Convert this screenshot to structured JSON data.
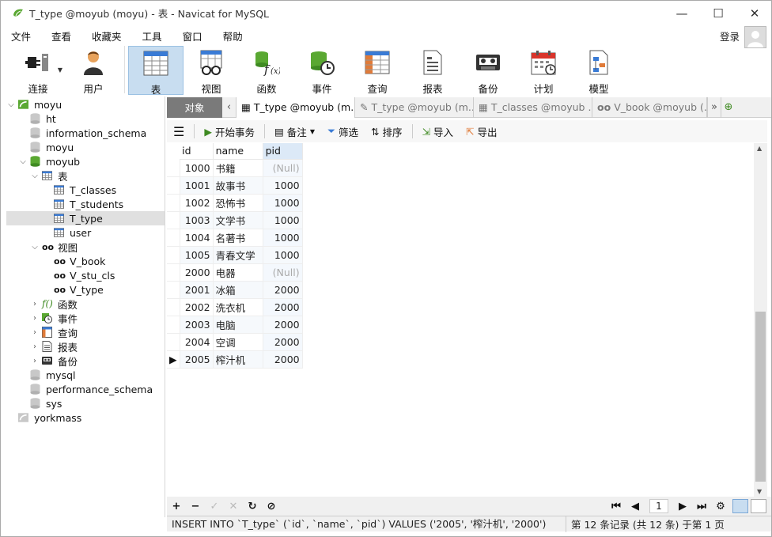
{
  "window": {
    "title": "T_type @moyub (moyu) - 表 - Navicat for MySQL",
    "controls": {
      "minimize": "—",
      "maximize": "☐",
      "close": "✕"
    }
  },
  "menu": [
    "文件",
    "查看",
    "收藏夹",
    "工具",
    "窗口",
    "帮助"
  ],
  "login_label": "登录",
  "toolbar": [
    {
      "label": "连接",
      "icon": "connection-icon",
      "dropdown": true
    },
    {
      "label": "用户",
      "icon": "user-icon"
    },
    {
      "label": "表",
      "icon": "table-icon",
      "active": true
    },
    {
      "label": "视图",
      "icon": "view-icon"
    },
    {
      "label": "函数",
      "icon": "function-icon"
    },
    {
      "label": "事件",
      "icon": "event-icon"
    },
    {
      "label": "查询",
      "icon": "query-icon"
    },
    {
      "label": "报表",
      "icon": "report-icon"
    },
    {
      "label": "备份",
      "icon": "backup-icon"
    },
    {
      "label": "计划",
      "icon": "schedule-icon"
    },
    {
      "label": "模型",
      "icon": "model-icon"
    }
  ],
  "tree": {
    "connection": "moyu",
    "databases_top": [
      "ht",
      "information_schema",
      "moyu"
    ],
    "open_db": "moyub",
    "tables_group": "表",
    "tables": [
      "T_classes",
      "T_students",
      "T_type",
      "user"
    ],
    "selected_table": "T_type",
    "views_group": "视图",
    "views": [
      "V_book",
      "V_stu_cls",
      "V_type"
    ],
    "groups_collapsed": [
      "函数",
      "事件",
      "查询",
      "报表",
      "备份"
    ],
    "databases_bottom": [
      "mysql",
      "performance_schema",
      "sys"
    ],
    "connection2": "yorkmass"
  },
  "tabs": {
    "objects_label": "对象",
    "items": [
      {
        "label": "T_type @moyub (m...",
        "active": true
      },
      {
        "label": "T_type @moyub (m..."
      },
      {
        "label": "T_classes @moyub ..."
      },
      {
        "label": "V_book @moyub (..."
      }
    ]
  },
  "grid_tools": {
    "begin_transaction": "开始事务",
    "note": "备注",
    "filter": "筛选",
    "sort": "排序",
    "import": "导入",
    "export": "导出"
  },
  "table": {
    "columns": [
      "id",
      "name",
      "pid"
    ],
    "rows": [
      {
        "id": "1000",
        "name": "书籍",
        "pid": "(Null)"
      },
      {
        "id": "1001",
        "name": "故事书",
        "pid": "1000"
      },
      {
        "id": "1002",
        "name": "恐怖书",
        "pid": "1000"
      },
      {
        "id": "1003",
        "name": "文学书",
        "pid": "1000"
      },
      {
        "id": "1004",
        "name": "名著书",
        "pid": "1000"
      },
      {
        "id": "1005",
        "name": "青春文学",
        "pid": "1000"
      },
      {
        "id": "2000",
        "name": "电器",
        "pid": "(Null)"
      },
      {
        "id": "2001",
        "name": "冰箱",
        "pid": "2000"
      },
      {
        "id": "2002",
        "name": "洗衣机",
        "pid": "2000"
      },
      {
        "id": "2003",
        "name": "电脑",
        "pid": "2000"
      },
      {
        "id": "2004",
        "name": "空调",
        "pid": "2000"
      },
      {
        "id": "2005",
        "name": "榨汁机",
        "pid": "2000"
      }
    ],
    "current_row_index": 11
  },
  "nav": {
    "page": "1"
  },
  "status": {
    "sql": "INSERT INTO `T_type` (`id`, `name`, `pid`) VALUES ('2005', '榨汁机', '2000')",
    "records": "第 12 条记录 (共 12 条) 于第 1 页"
  }
}
